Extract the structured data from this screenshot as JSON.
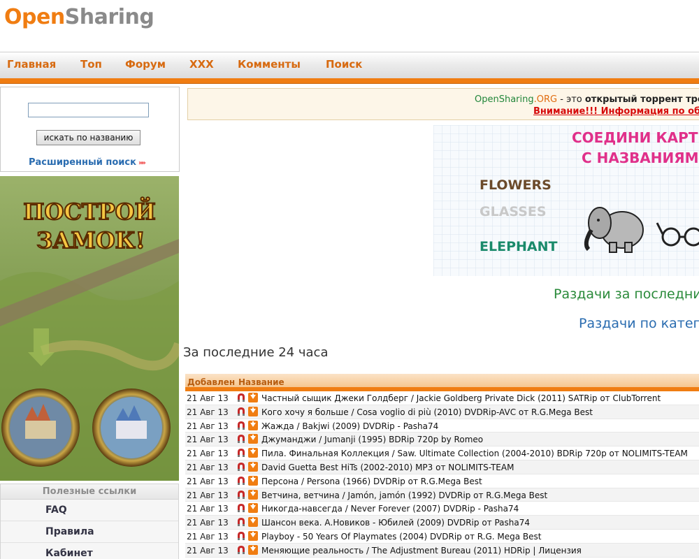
{
  "logo": {
    "part1": "Open",
    "part2": "Sharing"
  },
  "nav": {
    "items": [
      "Главная",
      "Топ",
      "Форум",
      "XXX",
      "Комменты",
      "Поиск"
    ]
  },
  "search": {
    "input_value": "",
    "button_label": "искать по названию",
    "advanced_link": "Расширенный поиск"
  },
  "banner_left": {
    "text_line1": "ПОСТРОЙ",
    "text_line2": "ЗАМОК!"
  },
  "useful_links": {
    "heading": "Полезные ссылки",
    "items": [
      "FAQ",
      "Правила",
      "Кабинет"
    ]
  },
  "notice": {
    "site_part1": "OpenSharing",
    "site_part2": ".ORG",
    "text": " - это ",
    "bold_text": "открытый торрент тре",
    "warning": "Внимание!!! Информация по обхо"
  },
  "ad_right": {
    "title_line1": "СОЕДИНИ КАРТИНК",
    "title_line2": "С НАЗВАНИЯМИ",
    "word1": "FLOWERS",
    "word2": "GLASSES",
    "word3": "ELEPHANT"
  },
  "main": {
    "recent_link": "Раздачи за последни",
    "category_link": "Раздачи по катего",
    "section_title": "За последние 24 часа"
  },
  "table": {
    "columns": [
      "Добавлен",
      "Название"
    ],
    "rows": [
      {
        "date": "21 Авг 13",
        "title": "Частный сыщик Джеки Голдберг / Jackie Goldberg Private Dick (2011) SATRip от ClubTorrent"
      },
      {
        "date": "21 Авг 13",
        "title": "Кого хочу я больше / Cosa voglio di più (2010) DVDRip-AVC от R.G.Mega Best"
      },
      {
        "date": "21 Авг 13",
        "title": "Жажда / Bakjwi (2009) DVDRip - Pasha74"
      },
      {
        "date": "21 Авг 13",
        "title": "Джуманджи / Jumanji (1995) BDRip 720p by Romeo"
      },
      {
        "date": "21 Авг 13",
        "title": "Пила. Финальная Коллекция / Saw. Ultimate Collection (2004-2010) BDRip 720p от NOLIMITS-TEAM"
      },
      {
        "date": "21 Авг 13",
        "title": "David Guetta Best HiTs (2002-2010) MP3 от NOLIMITS-TEAM"
      },
      {
        "date": "21 Авг 13",
        "title": "Персона / Persona (1966) DVDRip от R.G.Mega Best"
      },
      {
        "date": "21 Авг 13",
        "title": "Ветчина, ветчина / Jamón, jamón (1992) DVDRip от R.G.Mega Best"
      },
      {
        "date": "21 Авг 13",
        "title": "Никогда-навсегда / Never Forever (2007) DVDRip - Pasha74"
      },
      {
        "date": "21 Авг 13",
        "title": "Шансон века. А.Новиков - Юбилей (2009) DVDRip от Pasha74"
      },
      {
        "date": "21 Авг 13",
        "title": "Playboy - 50 Years Of Playmates (2004) DVDRip от R.G. Mega Best"
      },
      {
        "date": "21 Авг 13",
        "title": "Меняющие реальность / The Adjustment Bureau (2011) HDRip | Лицензия"
      }
    ]
  },
  "colors": {
    "accent": "#f07d12",
    "link": "#2a6cb0",
    "green": "#2a8a3a",
    "warning": "#d60a0a"
  }
}
